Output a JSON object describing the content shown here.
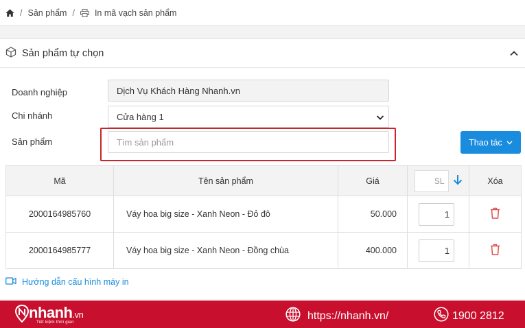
{
  "breadcrumb": {
    "items": [
      {
        "label": "Sản phẩm",
        "icon": "home-icon"
      },
      {
        "label": "In mã vạch sản phẩm",
        "icon": "printer-icon"
      }
    ]
  },
  "card": {
    "title": "Sản phẩm tự chọn"
  },
  "form": {
    "company_label": "Doanh nghiệp",
    "company_value": "Dịch Vụ Khách Hàng Nhanh.vn",
    "branch_label": "Chi nhánh",
    "branch_value": "Cửa hàng 1",
    "product_label": "Sản phẩm",
    "product_placeholder": "Tìm sản phẩm",
    "action_label": "Thao tác"
  },
  "table": {
    "headers": {
      "code": "Mã",
      "name": "Tên sản phẩm",
      "price": "Giá",
      "qty": "SL",
      "delete": "Xóa"
    },
    "rows": [
      {
        "code": "2000164985760",
        "name": "Váy hoa big size - Xanh Neon - Đỏ đô",
        "price": "50.000",
        "qty": "1"
      },
      {
        "code": "2000164985777",
        "name": "Váy hoa big size - Xanh Neon - Đồng chùa",
        "price": "400.000",
        "qty": "1"
      }
    ]
  },
  "guide_link": "Hướng dẫn cấu hình máy in",
  "footer": {
    "brand": "nhanh",
    "brand_suffix": ".vn",
    "tagline": "Tiết kiệm thời gian",
    "website": "https://nhanh.vn/",
    "phone": "1900 2812"
  },
  "colors": {
    "accent": "#1a8cde",
    "highlight": "#c9252c",
    "footer_bg": "#c8102e",
    "delete_icon": "#e24b4b"
  }
}
